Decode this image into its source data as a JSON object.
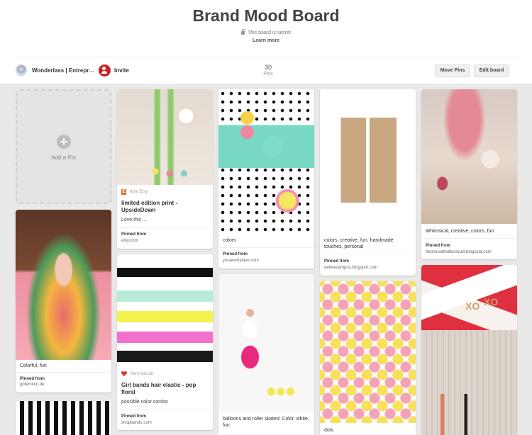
{
  "board": {
    "title": "Brand Mood Board",
    "secret_text": "This board is secret",
    "learn_more": "Learn more",
    "owner": "Wonderlass | Entrepr…",
    "invite": "Invite",
    "pins_count": "30",
    "pins_label": "Pins",
    "move_pins": "Move Pins",
    "edit_board": "Edit board"
  },
  "add_pin": {
    "label": "Add a Pin"
  },
  "pins": {
    "p1": {
      "source_site": "from Etsy",
      "title": "limited edition print - UpsideDown",
      "note": "Love this ...",
      "pinned_from_label": "Pinned from",
      "pinned_from": "etsy.com"
    },
    "p2": {
      "desc": "Colorful, fun",
      "pinned_from_label": "Pinned from",
      "pinned_from": "gofeminin.de"
    },
    "p3": {
      "source_site": "from ban.do",
      "title": "Girl bands hair elastic - pop floral",
      "note": "possible color combo",
      "pinned_from_label": "Pinned from",
      "pinned_from": "shopbando.com"
    },
    "p4": {
      "desc": "colors",
      "pinned_from_label": "Pinned from",
      "pinned_from": "youaremyfave.com"
    },
    "p5": {
      "desc": "balloons and roller skates! Color, white, fun"
    },
    "p6": {
      "desc": "colors, creative, fun, handmade touches, personal",
      "pinned_from_label": "Pinned from",
      "pinned_from": "debeecampos.blogspot.com"
    },
    "p7": {
      "desc": "dots"
    },
    "p8": {
      "desc": "Whimsical, creative, colors, fun",
      "pinned_from_label": "Pinned from",
      "pinned_from": "thehousethatlarsbuilt.blogspot.com"
    },
    "p9": {
      "img_text_1": "XO",
      "img_text_2": "XO"
    }
  }
}
